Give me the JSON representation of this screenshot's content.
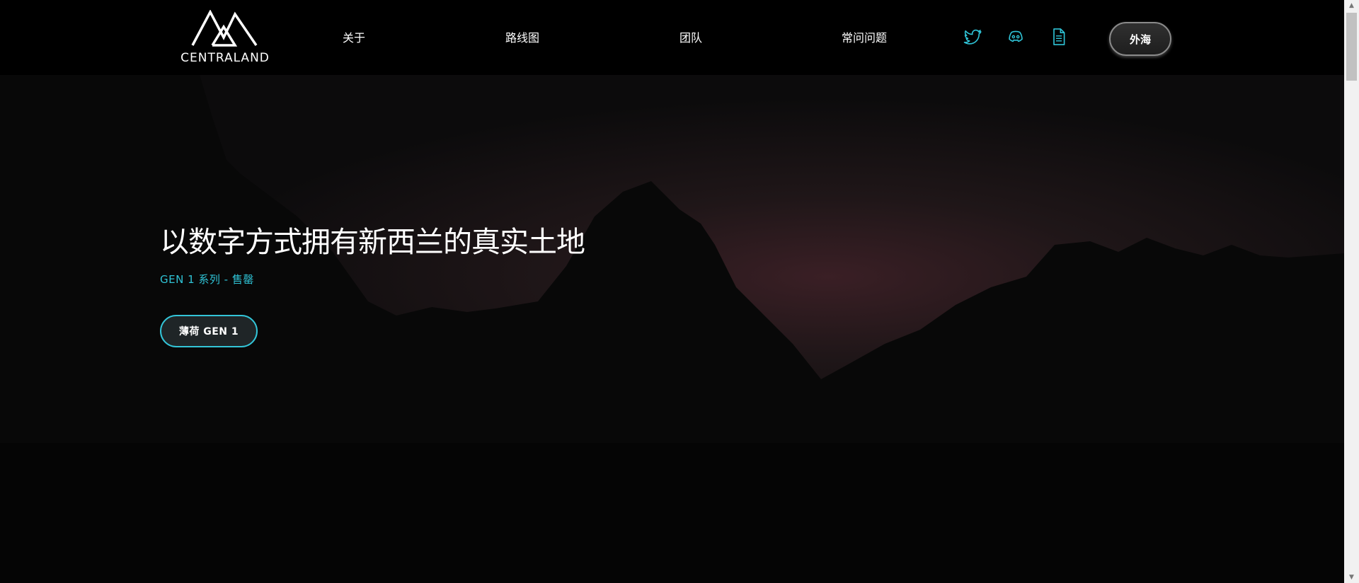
{
  "header": {
    "logo_text": "CENTRALAND",
    "nav": {
      "about": "关于",
      "roadmap": "路线图",
      "team": "团队",
      "faq": "常问问题"
    },
    "social_icons": [
      "twitter-icon",
      "discord-icon",
      "document-icon"
    ],
    "cta_label": "外海"
  },
  "hero": {
    "title": "以数字方式拥有新西兰的真实土地",
    "subtitle": "GEN 1 系列 - 售罄",
    "mint_button": "薄荷 GEN 1"
  },
  "colors": {
    "accent": "#2fc3d6",
    "background": "#000000",
    "sky_glow": "#3a1f25"
  }
}
